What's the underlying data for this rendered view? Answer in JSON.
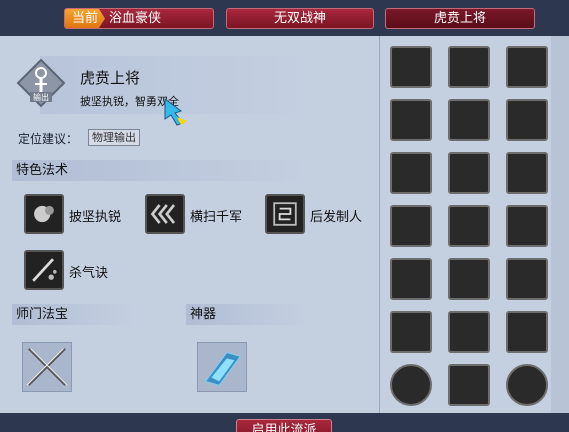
{
  "tabs": {
    "current_badge": "当前",
    "items": [
      "浴血豪侠",
      "无双战神",
      "虎贲上将"
    ]
  },
  "role": {
    "icon_label": "输出",
    "title": "虎贲上将",
    "subtitle": "披坚执锐，智勇双全",
    "position_label": "定位建议：",
    "position_value": "物理输出"
  },
  "sections": {
    "special_skills": "特色法术",
    "sect_treasure": "师门法宝",
    "artifact": "神器"
  },
  "skills": [
    {
      "label": "披坚执锐",
      "icon": "armor-fist-icon"
    },
    {
      "label": "横扫千军",
      "icon": "triple-chevron-icon"
    },
    {
      "label": "后发制人",
      "icon": "counter-rune-icon"
    },
    {
      "label": "杀气诀",
      "icon": "sword-aura-icon"
    }
  ],
  "treasures": {
    "sect": "crossed-swords-icon",
    "artifact": "crystal-blade-icon"
  },
  "grid_icons": [
    "burst-icon",
    "kneel-figure-icon",
    "swirl-icon",
    "spark-figure-icon",
    "blade-cross-icon",
    "claw-slash-icon",
    "slash-arc-icon",
    "broken-heart-icon",
    "dash-arrow-icon",
    "skull-fist-icon",
    "figures-icon",
    "hand-swirl-icon",
    "dagger-rain-icon",
    "running-figure-icon",
    "cracked-heart-icon",
    "falling-sword-icon",
    "yong-seal-icon",
    "scroll-icon",
    "spiral-orb-icon",
    "triple-chevron-icon",
    "spiral-orb-icon"
  ],
  "bottom": {
    "apply_label": "启用此流派"
  },
  "colors": {
    "tab_red": "#8c1c2e",
    "badge_orange": "#f39a28",
    "panel_bg": "#c4cfe0",
    "frame_dark": "#2d3850"
  }
}
